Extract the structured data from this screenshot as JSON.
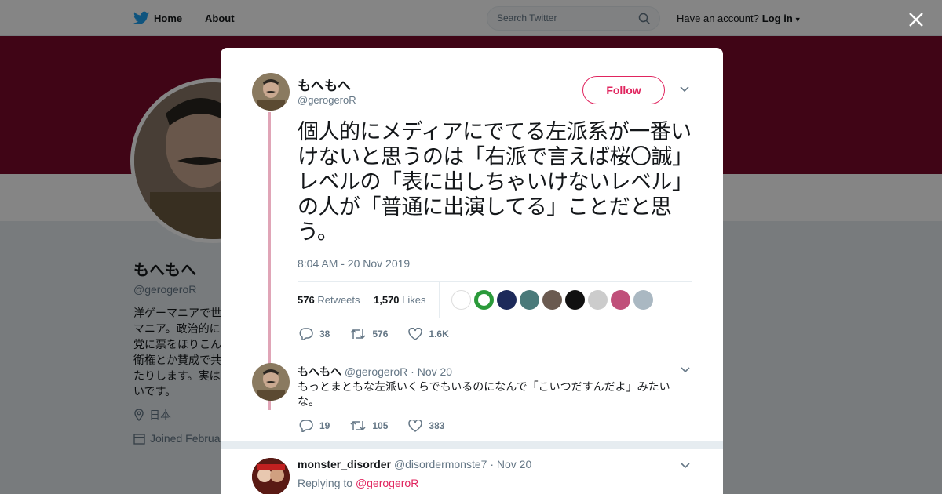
{
  "nav": {
    "home": "Home",
    "about": "About",
    "search_placeholder": "Search Twitter",
    "have_account": "Have an account?",
    "login": "Log in"
  },
  "profile": {
    "name": "もへもへ",
    "handle": "@gerogeroR",
    "bio": "洋ゲーマニアで世\nマニア。政治的に\n党に票をほりこん\n衛権とか賛成で共\nたりします。実は\nいです。",
    "location": "日本",
    "joined": "Joined Februa"
  },
  "tweet": {
    "author_name": "もへもへ",
    "author_handle": "@gerogeroR",
    "follow_label": "Follow",
    "text": "個人的にメディアにでてる左派系が一番いけないと思うのは「右派で言えば桜〇誠」レベルの「表に出しちゃいけないレベル」の人が「普通に出演してる」ことだと思う。",
    "timestamp": "8:04 AM - 20 Nov 2019",
    "retweets_count": "576",
    "retweets_label": "Retweets",
    "likes_count": "1,570",
    "likes_label": "Likes",
    "reply_count": "38",
    "retweet_action_count": "576",
    "like_action_count": "1.6K"
  },
  "replies": [
    {
      "name": "もへもへ",
      "handle": "@gerogeroR",
      "date": "· Nov 20",
      "text": "もっとまともな左派いくらでもいるのになんで「こいつだすんだよ」みたいな。",
      "reply_count": "19",
      "retweet_count": "105",
      "like_count": "383"
    },
    {
      "name": "monster_disorder",
      "handle": "@disordermonste7",
      "date": "· Nov 20",
      "replying_label": "Replying to",
      "replying_to": "@gerogeroR"
    }
  ],
  "colors": {
    "accent": "#e0245e",
    "banner": "#7c0a2b",
    "twitter_blue": "#1da1f2"
  }
}
